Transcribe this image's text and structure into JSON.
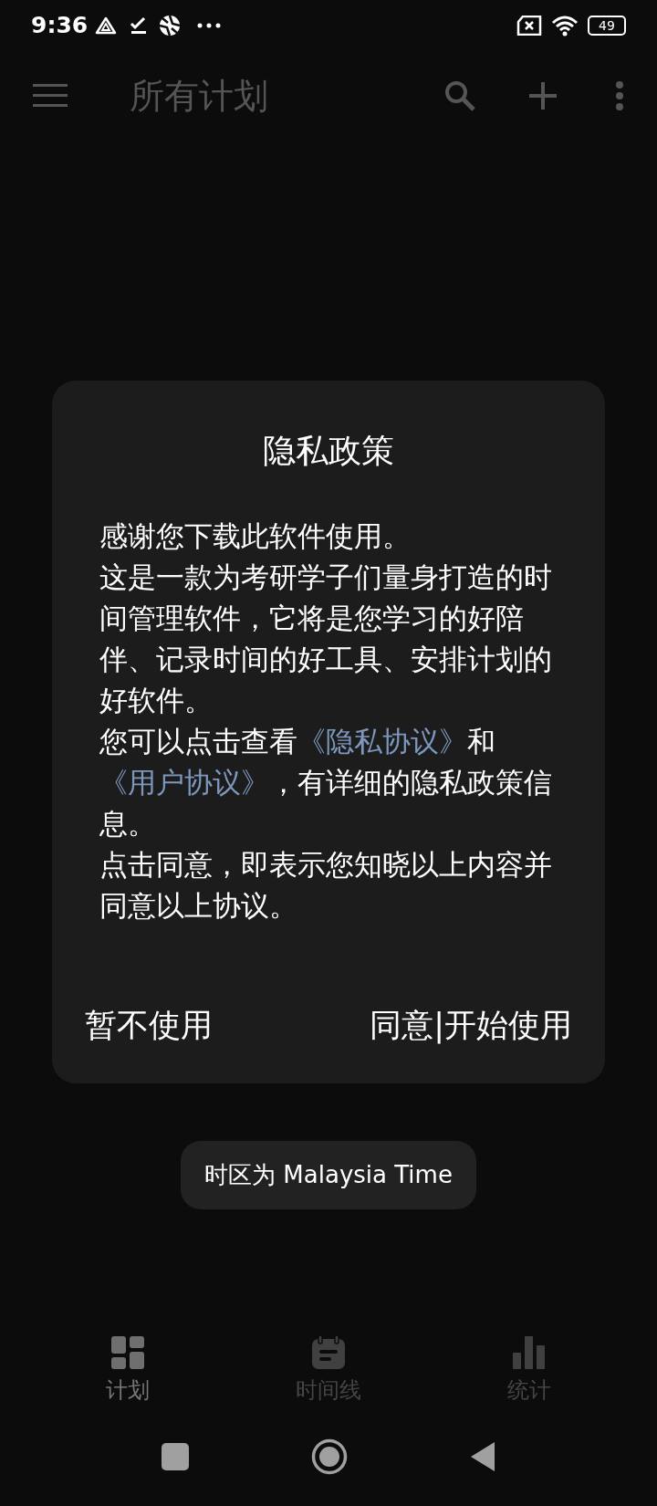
{
  "status_bar": {
    "time": "9:36",
    "battery": "49"
  },
  "app_bar": {
    "title": "所有计划"
  },
  "dialog": {
    "title": "隐私政策",
    "paragraphs": [
      [
        {
          "kind": "text",
          "text": "感谢您下载此软件使用。"
        }
      ],
      [
        {
          "kind": "text",
          "text": "这是一款为考研学子们量身打造的时间管理软件，它将是您学习的好陪伴、记录时间的好工具、安排计划的好软件。"
        }
      ],
      [
        {
          "kind": "text",
          "text": "您可以点击查看"
        },
        {
          "kind": "link",
          "text": "《隐私协议》"
        },
        {
          "kind": "text",
          "text": "和"
        },
        {
          "kind": "link",
          "text": "《用户协议》"
        },
        {
          "kind": "text",
          "text": "，有详细的隐私政策信息。"
        }
      ],
      [
        {
          "kind": "text",
          "text": "点击同意，即表示您知晓以上内容并同意以上协议。"
        }
      ]
    ],
    "buttons": [
      "暂不使用",
      "同意|开始使用"
    ]
  },
  "toast": "时区为 Malaysia Time",
  "bottom_nav": [
    {
      "label": "计划",
      "selected": true,
      "kind": "plan"
    },
    {
      "label": "时间线",
      "selected": false,
      "kind": "timeline"
    },
    {
      "label": "统计",
      "selected": false,
      "kind": "stats"
    }
  ]
}
